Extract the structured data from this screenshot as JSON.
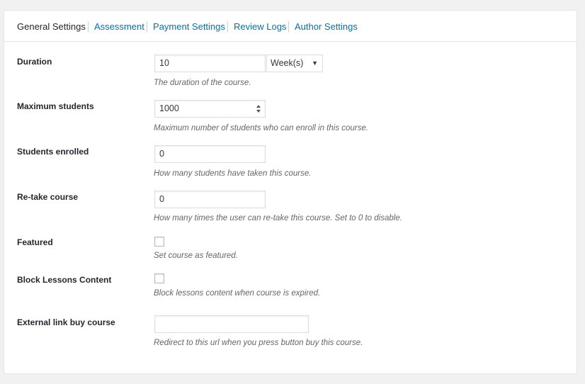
{
  "tabs": [
    {
      "label": "General Settings",
      "active": true
    },
    {
      "label": "Assessment",
      "active": false
    },
    {
      "label": "Payment Settings",
      "active": false
    },
    {
      "label": "Review Logs",
      "active": false
    },
    {
      "label": "Author Settings",
      "active": false
    }
  ],
  "fields": {
    "duration": {
      "label": "Duration",
      "value": "10",
      "unit_selected": "Week(s)",
      "description": "The duration of the course."
    },
    "max_students": {
      "label": "Maximum students",
      "value": "1000",
      "description": "Maximum number of students who can enroll in this course."
    },
    "students_enrolled": {
      "label": "Students enrolled",
      "value": "0",
      "description": "How many students have taken this course."
    },
    "retake": {
      "label": "Re-take course",
      "value": "0",
      "description": "How many times the user can re-take this course. Set to 0 to disable."
    },
    "featured": {
      "label": "Featured",
      "checked": false,
      "description": "Set course as featured."
    },
    "block_lessons": {
      "label": "Block Lessons Content",
      "checked": false,
      "description": "Block lessons content when course is expired."
    },
    "external_link": {
      "label": "External link buy course",
      "value": "",
      "description": "Redirect to this url when you press button buy this course."
    }
  },
  "colors": {
    "link": "#0073aa",
    "text": "#23282d",
    "description": "#666666",
    "border": "#dddddd"
  }
}
